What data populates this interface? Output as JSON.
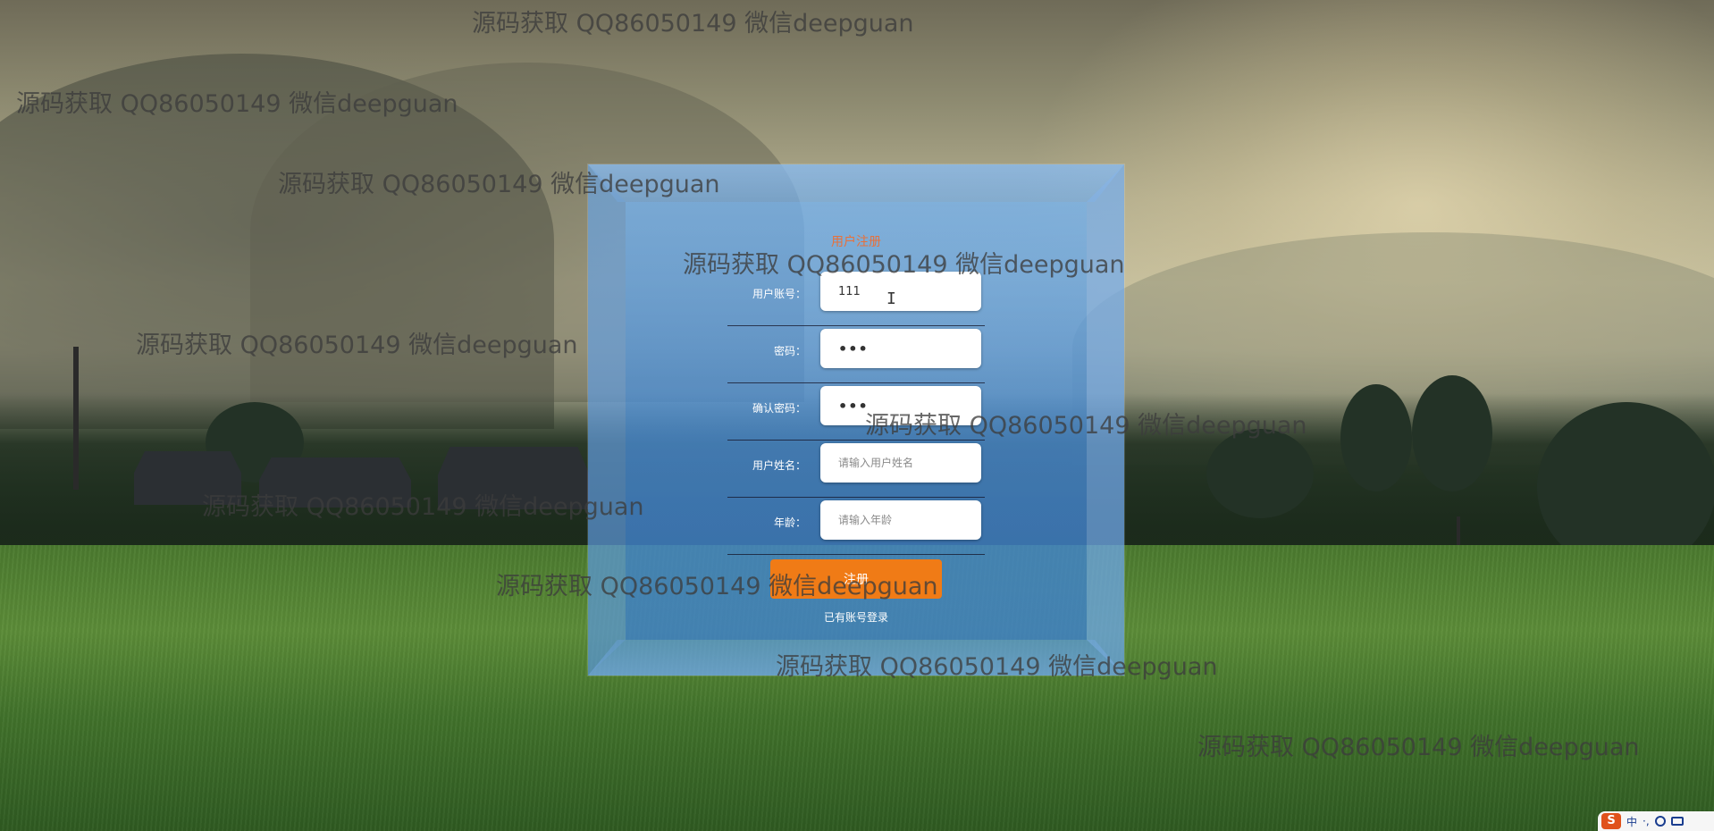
{
  "form": {
    "title": "用户注册",
    "fields": [
      {
        "label": "用户账号：",
        "value": "111",
        "placeholder": "",
        "type": "text"
      },
      {
        "label": "密码：",
        "value": "•••",
        "placeholder": "",
        "type": "password"
      },
      {
        "label": "确认密码：",
        "value": "•••",
        "placeholder": "",
        "type": "password"
      },
      {
        "label": "用户姓名：",
        "value": "",
        "placeholder": "请输入用户姓名",
        "type": "text"
      },
      {
        "label": "年龄：",
        "value": "",
        "placeholder": "请输入年龄",
        "type": "text"
      }
    ],
    "register_label": "注册",
    "login_link": "已有账号登录"
  },
  "watermark_text": "源码获取 QQ86050149 微信deepguan",
  "ime": {
    "logo": "S",
    "lang": "中",
    "punct": "·,",
    "emoji_icon": "emoji-icon",
    "keyboard_icon": "keyboard-icon"
  },
  "colors": {
    "accent": "#f07b16",
    "title": "#e8703a",
    "panel": "#4a8fd8"
  }
}
